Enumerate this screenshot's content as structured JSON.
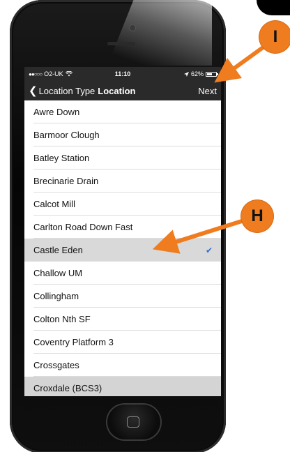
{
  "status_bar": {
    "carrier": "O2-UK",
    "time": "11:10",
    "battery_text": "62%",
    "battery_level": 0.62
  },
  "nav": {
    "back_label": "Location Type",
    "title": "Location",
    "next_label": "Next"
  },
  "locations": [
    {
      "name": "Awre Down"
    },
    {
      "name": "Barmoor Clough"
    },
    {
      "name": "Batley Station"
    },
    {
      "name": "Brecinarie Drain"
    },
    {
      "name": "Calcot Mill"
    },
    {
      "name": "Carlton Road Down Fast"
    },
    {
      "name": "Castle Eden",
      "selected": true
    },
    {
      "name": "Challow UM"
    },
    {
      "name": "Collingham"
    },
    {
      "name": "Colton Nth SF"
    },
    {
      "name": "Coventry Platform 3"
    },
    {
      "name": "Crossgates"
    },
    {
      "name": "Croxdale (BCS3)",
      "shaded": true
    }
  ],
  "annotations": {
    "callout_i": "I",
    "callout_h": "H"
  },
  "colors": {
    "annotation_accent": "#ef7c1f",
    "nav_background": "#2a2a2a",
    "checkmark": "#2e6fd6",
    "selected_row": "#d9d9d9"
  },
  "icons": {
    "back": "chevron-left-icon",
    "check": "checkmark-icon",
    "battery": "battery-icon",
    "wifi": "wifi-icon",
    "location": "location-arrow-icon"
  }
}
